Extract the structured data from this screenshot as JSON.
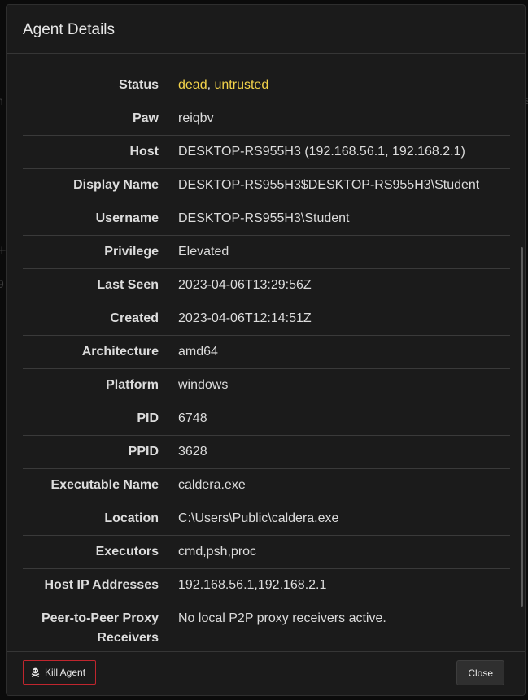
{
  "modal": {
    "title": "Agent Details"
  },
  "background": {
    "glyphs": [
      "n",
      "+",
      "9",
      "s"
    ]
  },
  "status": {
    "label": "Status",
    "dead": "dead",
    "separator": ",",
    "untrusted": "untrusted",
    "color": "#f3d34a"
  },
  "rows": [
    {
      "label": "Paw",
      "value": "reiqbv"
    },
    {
      "label": "Host",
      "value": "DESKTOP-RS955H3 (192.168.56.1, 192.168.2.1)"
    },
    {
      "label": "Display Name",
      "value": "DESKTOP-RS955H3$DESKTOP-RS955H3\\Student"
    },
    {
      "label": "Username",
      "value": "DESKTOP-RS955H3\\Student"
    },
    {
      "label": "Privilege",
      "value": "Elevated"
    },
    {
      "label": "Last Seen",
      "value": "2023-04-06T13:29:56Z"
    },
    {
      "label": "Created",
      "value": "2023-04-06T12:14:51Z"
    },
    {
      "label": "Architecture",
      "value": "amd64"
    },
    {
      "label": "Platform",
      "value": "windows"
    },
    {
      "label": "PID",
      "value": "6748"
    },
    {
      "label": "PPID",
      "value": "3628"
    },
    {
      "label": "Executable Name",
      "value": "caldera.exe"
    },
    {
      "label": "Location",
      "value": "C:\\Users\\Public\\caldera.exe"
    },
    {
      "label": "Executors",
      "value": "cmd,psh,proc"
    },
    {
      "label": "Host IP Addresses",
      "value": "192.168.56.1,192.168.2.1"
    },
    {
      "label": "Peer-to-Peer Proxy Receivers",
      "value": "No local P2P proxy receivers active."
    }
  ],
  "footer": {
    "kill_label": "Kill Agent",
    "kill_icon": "skull-crossbones-icon",
    "close_label": "Close",
    "danger_color": "#c0262e"
  }
}
